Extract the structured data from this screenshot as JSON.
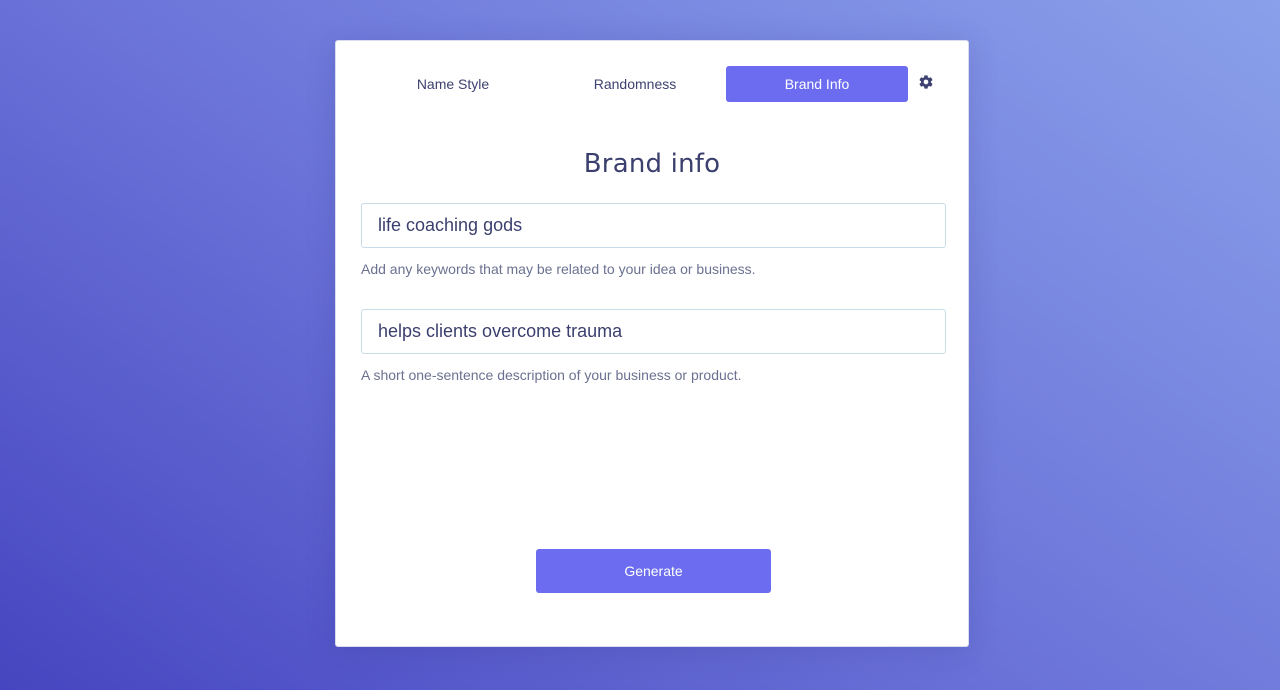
{
  "tabs": [
    {
      "label": "Name Style",
      "active": false
    },
    {
      "label": "Randomness",
      "active": false
    },
    {
      "label": "Brand Info",
      "active": true
    }
  ],
  "settings_icon": "gear-icon",
  "section_title": "Brand info",
  "keywords": {
    "value": "life coaching gods",
    "hint": "Add any keywords that may be related to your idea or business."
  },
  "description": {
    "value": "helps clients overcome trauma",
    "hint": "A short one-sentence description of your business or product."
  },
  "generate_label": "Generate",
  "colors": {
    "accent": "#6b6cef",
    "text": "#3b3f6e",
    "hint": "#6b7190"
  }
}
